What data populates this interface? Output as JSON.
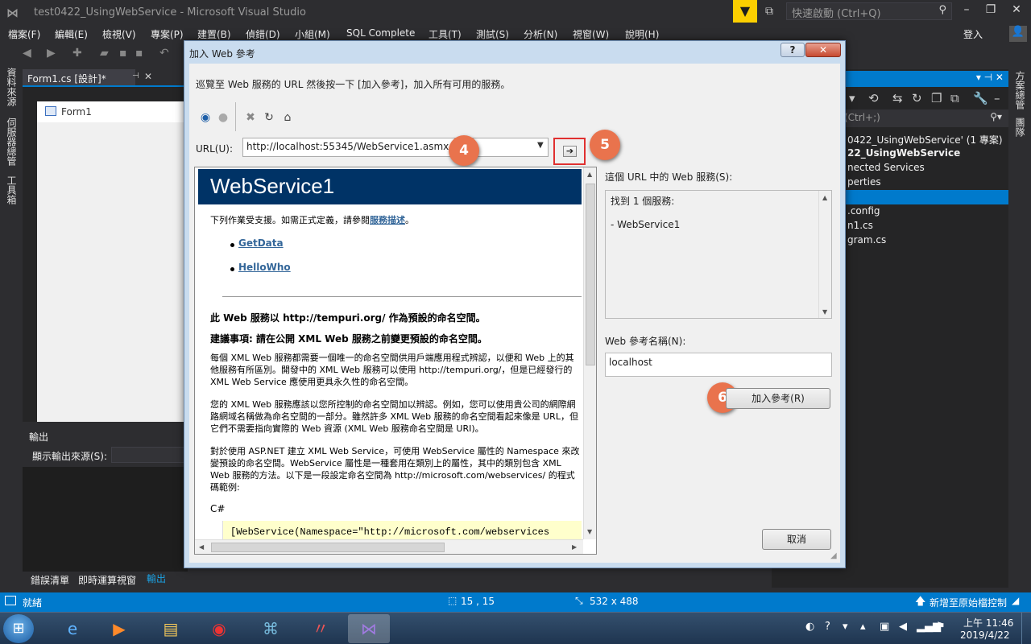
{
  "window": {
    "title": "test0422_UsingWebService - Microsoft Visual Studio",
    "quick_launch_placeholder": "快速啟動 (Ctrl+Q)",
    "login": "登入"
  },
  "menu": [
    "檔案(F)",
    "編輯(E)",
    "檢視(V)",
    "專案(P)",
    "建置(B)",
    "偵錯(D)",
    "小組(M)",
    "SQL Complete",
    "工具(T)",
    "測試(S)",
    "分析(N)",
    "視窗(W)",
    "說明(H)"
  ],
  "left_side_tabs": [
    "資料來源",
    "伺服器總管",
    "工具箱"
  ],
  "document_tab": "Form1.cs [設計]*",
  "designer": {
    "form_title": "Form1"
  },
  "output": {
    "title": "輸出",
    "source_label": "顯示輸出來源(S):",
    "bottom_tabs": [
      "錯誤清單",
      "即時運算視窗",
      "輸出"
    ]
  },
  "solution_explorer": {
    "search_placeholder": "(Ctrl+;)",
    "items": [
      "0422_UsingWebService' (1 專案)",
      "22_UsingWebService",
      "nected Services",
      "perties",
      "",
      ".config",
      "n1.cs",
      "gram.cs"
    ],
    "right_tabs": [
      "方案總管",
      "團隊"
    ]
  },
  "statusbar": {
    "text": "就緒",
    "position": "15 , 15",
    "size": "532 x 488",
    "publish": "新增至原始檔控制"
  },
  "taskbar": {
    "time": "上午 11:46",
    "date": "2019/4/22"
  },
  "dialog": {
    "title": "加入 Web 參考",
    "help": "?",
    "close": "✕",
    "instructions": "巡覽至 Web 服務的 URL 然後按一下 [加入參考]，加入所有可用的服務。",
    "url_label": "URL(U):",
    "url_value": "http://localhost:55345/WebService1.asmx",
    "go_glyph": "➔",
    "callouts": [
      "4",
      "5",
      "6"
    ],
    "services_label": "這個 URL 中的 Web 服務(S):",
    "services_found": "找到 1 個服務:",
    "services_item": "- WebService1",
    "refname_label": "Web 參考名稱(N):",
    "refname_value": "localhost",
    "add_ref_button": "加入參考(R)",
    "cancel_button": "取消"
  },
  "browser": {
    "header": "WebService1",
    "intro_prefix": "下列作業受支援。如需正式定義，請參閱",
    "intro_link": "服務描述",
    "intro_suffix": "。",
    "ops": [
      "GetData",
      "HelloWho"
    ],
    "ns_line1": "此 Web 服務以 http://tempuri.org/ 作為預設的命名空間。",
    "ns_line2": "建議事項: 請在公開 XML Web 服務之前變更預設的命名空間。",
    "para1": "每個 XML Web 服務都需要一個唯一的命名空間供用戶端應用程式辨認，以便和 Web 上的其他服務有所區別。開發中的 XML Web 服務可以使用 http://tempuri.org/，但是已經發行的 XML Web Service 應使用更具永久性的命名空間。",
    "para2": "您的 XML Web 服務應該以您所控制的命名空間加以辨認。例如，您可以使用貴公司的網際網路網域名稱做為命名空間的一部分。雖然許多 XML Web 服務的命名空間看起來像是 URL，但它們不需要指向實際的 Web 資源 (XML Web 服務命名空間是 URI)。",
    "para3": "對於使用 ASP.NET 建立 XML Web Service，可使用 WebService 屬性的 Namespace 來改變預設的命名空間。WebService 屬性是一種套用在類別上的屬性，其中的類別包含 XML Web 服務的方法。以下是一段設定命名空間為 http://microsoft.com/webservices/ 的程式碼範例:",
    "lang": "C#",
    "code": "[WebService(Namespace=\"http://microsoft.com/webservices"
  }
}
